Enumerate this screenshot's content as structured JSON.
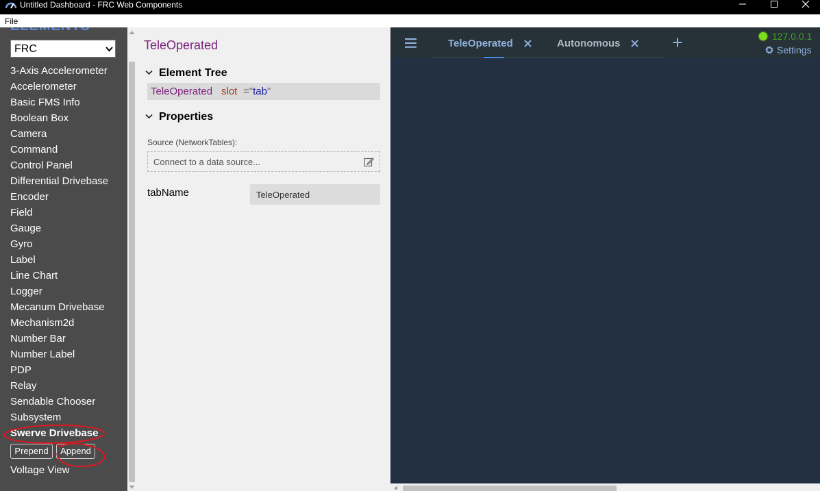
{
  "window": {
    "title": "Untitled Dashboard - FRC Web Components",
    "controls": [
      "minimize-icon",
      "maximize-icon",
      "close-icon"
    ]
  },
  "menubar": {
    "file": "File"
  },
  "sidebar": {
    "heading": "ELEMENTS",
    "source_select": {
      "value": "FRC"
    },
    "items": [
      "3-Axis Accelerometer",
      "Accelerometer",
      "Basic FMS Info",
      "Boolean Box",
      "Camera",
      "Command",
      "Control Panel",
      "Differential Drivebase",
      "Encoder",
      "Field",
      "Gauge",
      "Gyro",
      "Label",
      "Line Chart",
      "Logger",
      "Mecanum Drivebase",
      "Mechanism2d",
      "Number Bar",
      "Number Label",
      "PDP",
      "Relay",
      "Sendable Chooser",
      "Subsystem"
    ],
    "selected_item": "Swerve Drivebase",
    "prepend_label": "Prepend",
    "append_label": "Append",
    "after_item": "Voltage View",
    "annotation_color": "#e8141c"
  },
  "properties": {
    "title": "TeleOperated",
    "element_tree_heading": "Element Tree",
    "tree_row": {
      "tag": "TeleOperated",
      "attr_name": "slot",
      "attr_value": "tab"
    },
    "properties_heading": "Properties",
    "source_label": "Source (NetworkTables):",
    "source_placeholder": "Connect to a data source...",
    "prop_name": "tabName",
    "prop_value": "TeleOperated"
  },
  "dashboard": {
    "tabs": [
      {
        "label": "TeleOperated",
        "active": true
      },
      {
        "label": "Autonomous",
        "active": false
      }
    ],
    "connection": {
      "status_color": "#7bdc1a",
      "address": "127.0.0.1"
    },
    "settings_label": "Settings",
    "background_color": "#233044"
  }
}
